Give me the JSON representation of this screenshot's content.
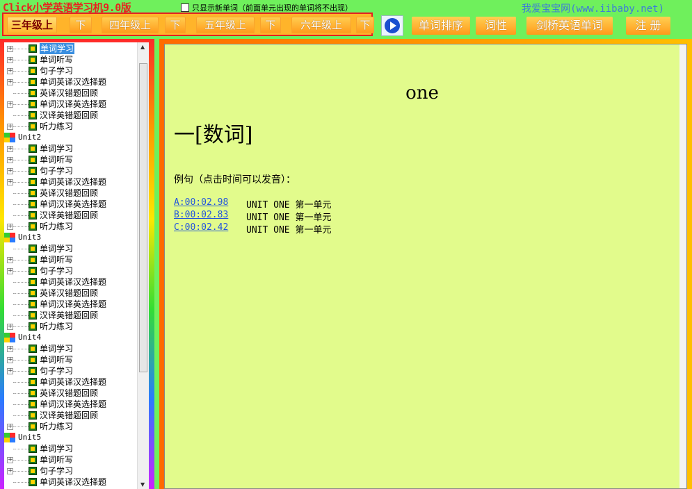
{
  "app": {
    "title": "Click小学英语学习机9.0版",
    "new_word_only": "只显示新单词（前面单元出现的单词将不出现）",
    "site": "我爱宝宝网(www.iibaby.net)"
  },
  "grades": [
    {
      "label": "三年级上",
      "selected": true
    },
    {
      "label": "下",
      "selected": false
    },
    {
      "label": "四年级上",
      "selected": false
    },
    {
      "label": "下",
      "selected": false
    },
    {
      "label": "五年级上",
      "selected": false
    },
    {
      "label": "下",
      "selected": false
    },
    {
      "label": "六年级上",
      "selected": false
    },
    {
      "label": "下",
      "selected": false
    }
  ],
  "functions": [
    "单词排序",
    "词性",
    "剑桥英语单词",
    "注 册"
  ],
  "tree": [
    {
      "type": "item",
      "label": "单词学习",
      "exp": true,
      "sel": true
    },
    {
      "type": "item",
      "label": "单词听写",
      "exp": true
    },
    {
      "type": "item",
      "label": "句子学习",
      "exp": true
    },
    {
      "type": "item",
      "label": "单词英译汉选择题",
      "exp": true
    },
    {
      "type": "item",
      "label": "英译汉错题回顾",
      "exp": false
    },
    {
      "type": "item",
      "label": "单词汉译英选择题",
      "exp": true
    },
    {
      "type": "item",
      "label": "汉译英错题回顾",
      "exp": false
    },
    {
      "type": "item",
      "label": "听力练习",
      "exp": true
    },
    {
      "type": "unit",
      "label": "Unit2"
    },
    {
      "type": "item",
      "label": "单词学习",
      "exp": true
    },
    {
      "type": "item",
      "label": "单词听写",
      "exp": true
    },
    {
      "type": "item",
      "label": "句子学习",
      "exp": true
    },
    {
      "type": "item",
      "label": "单词英译汉选择题",
      "exp": true
    },
    {
      "type": "item",
      "label": "英译汉错题回顾",
      "exp": false
    },
    {
      "type": "item",
      "label": "单词汉译英选择题",
      "exp": false
    },
    {
      "type": "item",
      "label": "汉译英错题回顾",
      "exp": false
    },
    {
      "type": "item",
      "label": "听力练习",
      "exp": true
    },
    {
      "type": "unit",
      "label": "Unit3"
    },
    {
      "type": "item",
      "label": "单词学习",
      "exp": false
    },
    {
      "type": "item",
      "label": "单词听写",
      "exp": true
    },
    {
      "type": "item",
      "label": "句子学习",
      "exp": true
    },
    {
      "type": "item",
      "label": "单词英译汉选择题",
      "exp": false
    },
    {
      "type": "item",
      "label": "英译汉错题回顾",
      "exp": false
    },
    {
      "type": "item",
      "label": "单词汉译英选择题",
      "exp": false
    },
    {
      "type": "item",
      "label": "汉译英错题回顾",
      "exp": false
    },
    {
      "type": "item",
      "label": "听力练习",
      "exp": true
    },
    {
      "type": "unit",
      "label": "Unit4"
    },
    {
      "type": "item",
      "label": "单词学习",
      "exp": true
    },
    {
      "type": "item",
      "label": "单词听写",
      "exp": true
    },
    {
      "type": "item",
      "label": "句子学习",
      "exp": true
    },
    {
      "type": "item",
      "label": "单词英译汉选择题",
      "exp": false
    },
    {
      "type": "item",
      "label": "英译汉错题回顾",
      "exp": false
    },
    {
      "type": "item",
      "label": "单词汉译英选择题",
      "exp": false
    },
    {
      "type": "item",
      "label": "汉译英错题回顾",
      "exp": false
    },
    {
      "type": "item",
      "label": "听力练习",
      "exp": true
    },
    {
      "type": "unit",
      "label": "Unit5"
    },
    {
      "type": "item",
      "label": "单词学习",
      "exp": false
    },
    {
      "type": "item",
      "label": "单词听写",
      "exp": true
    },
    {
      "type": "item",
      "label": "句子学习",
      "exp": true
    },
    {
      "type": "item",
      "label": "单词英译汉选择题",
      "exp": false
    }
  ],
  "content": {
    "word": "one",
    "meaning": "一[数词]",
    "example_title": "例句（点击时间可以发音）：",
    "examples": [
      {
        "time": "A:00:02.98",
        "text": "UNIT ONE 第一单元"
      },
      {
        "time": "B:00:02.83",
        "text": "UNIT ONE 第一单元"
      },
      {
        "time": "C:00:02.42",
        "text": "UNIT ONE 第一单元"
      }
    ]
  }
}
